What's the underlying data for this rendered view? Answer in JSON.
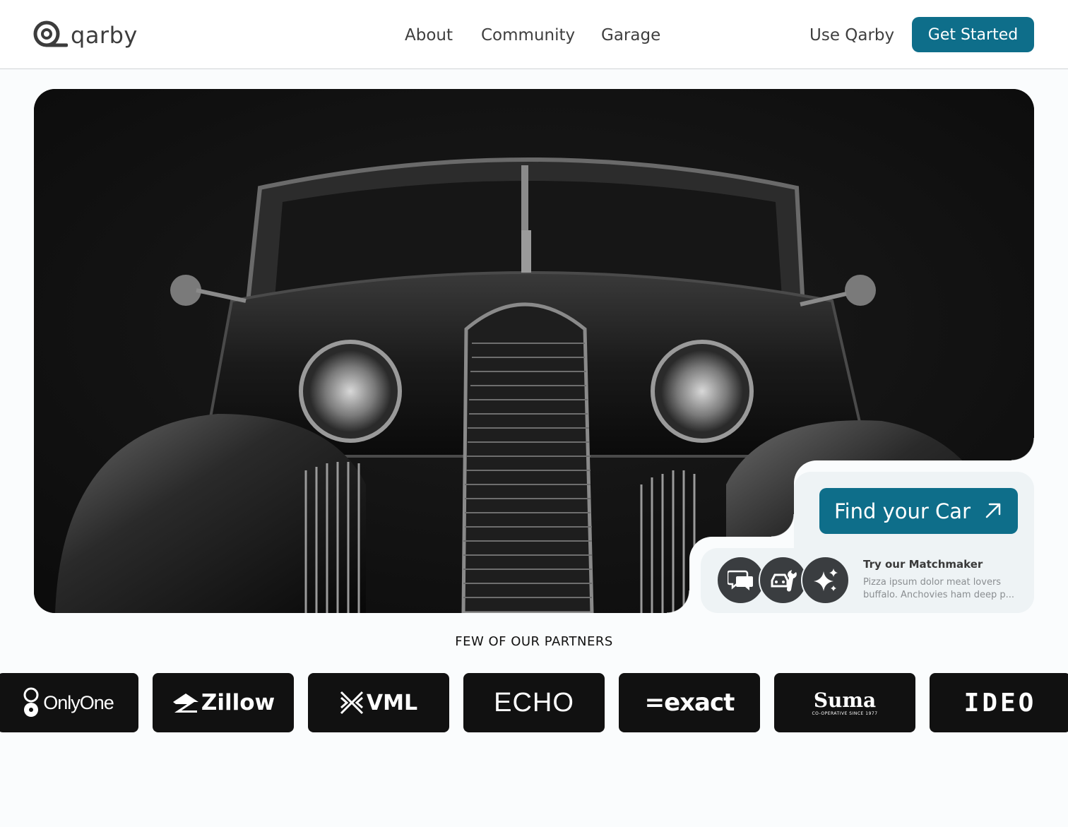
{
  "brand": {
    "name": "qarby",
    "accent": "#0e6e8a"
  },
  "nav": {
    "items": [
      "About",
      "Community",
      "Garage"
    ]
  },
  "header": {
    "use_link": "Use Qarby",
    "cta_label": "Get Started"
  },
  "hero": {
    "find_label": "Find your Car",
    "matchmaker_title": "Try our Matchmaker",
    "matchmaker_desc": "Pizza ipsum dolor meat lovers buffalo. Anchovies ham deep p...",
    "feature_icons": [
      "chat-bubbles-icon",
      "car-wrench-icon",
      "sparkles-icon"
    ]
  },
  "partners": {
    "title": "FEW OF OUR PARTNERS",
    "items": [
      "OnlyOne",
      "Zillow",
      "VML",
      "ECHO",
      "=exact",
      "Suma",
      "CO-OPERATIVE SINCE 1977",
      "IDEO"
    ]
  }
}
